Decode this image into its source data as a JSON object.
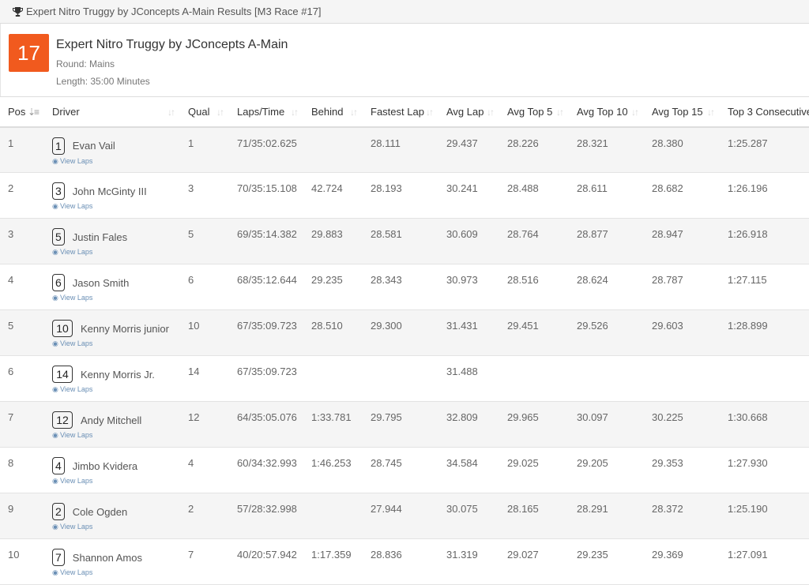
{
  "panel": {
    "title": "Expert Nitro Truggy by JConcepts A-Main Results [M3 Race #17]"
  },
  "race": {
    "number": "17",
    "name": "Expert Nitro Truggy by JConcepts A-Main",
    "round": "Round: Mains",
    "length": "Length: 35:00 Minutes"
  },
  "columns": [
    "Pos",
    "Driver",
    "Qual",
    "Laps/Time",
    "Behind",
    "Fastest Lap",
    "Avg Lap",
    "Avg Top 5",
    "Avg Top 10",
    "Avg Top 15",
    "Top 3 Consecutive"
  ],
  "view_laps_label": "View Laps",
  "rows": [
    {
      "pos": "1",
      "num": "1",
      "driver": "Evan Vail",
      "qual": "1",
      "laps": "71/35:02.625",
      "behind": "",
      "fastest": "28.111",
      "avg": "29.437",
      "top5": "28.226",
      "top10": "28.321",
      "top15": "28.380",
      "top3": "1:25.287"
    },
    {
      "pos": "2",
      "num": "3",
      "driver": "John McGinty III",
      "qual": "3",
      "laps": "70/35:15.108",
      "behind": "42.724",
      "fastest": "28.193",
      "avg": "30.241",
      "top5": "28.488",
      "top10": "28.611",
      "top15": "28.682",
      "top3": "1:26.196"
    },
    {
      "pos": "3",
      "num": "5",
      "driver": "Justin Fales",
      "qual": "5",
      "laps": "69/35:14.382",
      "behind": "29.883",
      "fastest": "28.581",
      "avg": "30.609",
      "top5": "28.764",
      "top10": "28.877",
      "top15": "28.947",
      "top3": "1:26.918"
    },
    {
      "pos": "4",
      "num": "6",
      "driver": "Jason Smith",
      "qual": "6",
      "laps": "68/35:12.644",
      "behind": "29.235",
      "fastest": "28.343",
      "avg": "30.973",
      "top5": "28.516",
      "top10": "28.624",
      "top15": "28.787",
      "top3": "1:27.115"
    },
    {
      "pos": "5",
      "num": "10",
      "driver": "Kenny Morris junior",
      "qual": "10",
      "laps": "67/35:09.723",
      "behind": "28.510",
      "fastest": "29.300",
      "avg": "31.431",
      "top5": "29.451",
      "top10": "29.526",
      "top15": "29.603",
      "top3": "1:28.899"
    },
    {
      "pos": "6",
      "num": "14",
      "driver": "Kenny Morris Jr.",
      "qual": "14",
      "laps": "67/35:09.723",
      "behind": "",
      "fastest": "",
      "avg": "31.488",
      "top5": "",
      "top10": "",
      "top15": "",
      "top3": ""
    },
    {
      "pos": "7",
      "num": "12",
      "driver": "Andy Mitchell",
      "qual": "12",
      "laps": "64/35:05.076",
      "behind": "1:33.781",
      "fastest": "29.795",
      "avg": "32.809",
      "top5": "29.965",
      "top10": "30.097",
      "top15": "30.225",
      "top3": "1:30.668"
    },
    {
      "pos": "8",
      "num": "4",
      "driver": "Jimbo Kvidera",
      "qual": "4",
      "laps": "60/34:32.993",
      "behind": "1:46.253",
      "fastest": "28.745",
      "avg": "34.584",
      "top5": "29.025",
      "top10": "29.205",
      "top15": "29.353",
      "top3": "1:27.930"
    },
    {
      "pos": "9",
      "num": "2",
      "driver": "Cole Ogden",
      "qual": "2",
      "laps": "57/28:32.998",
      "behind": "",
      "fastest": "27.944",
      "avg": "30.075",
      "top5": "28.165",
      "top10": "28.291",
      "top15": "28.372",
      "top3": "1:25.190"
    },
    {
      "pos": "10",
      "num": "7",
      "driver": "Shannon Amos",
      "qual": "7",
      "laps": "40/20:57.942",
      "behind": "1:17.359",
      "fastest": "28.836",
      "avg": "31.319",
      "top5": "29.027",
      "top10": "29.235",
      "top15": "29.369",
      "top3": "1:27.091"
    }
  ],
  "colors": {
    "badge": "#f15a1e",
    "link": "#6a8fb5",
    "stripe": "#f5f5f5"
  }
}
